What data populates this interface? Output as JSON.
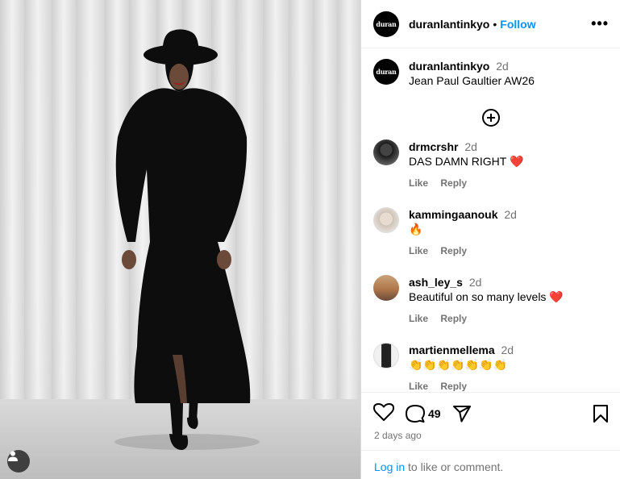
{
  "post": {
    "account": "duranlantinkyo",
    "logo_text": "duran",
    "follow_label": "Follow",
    "separator": "•",
    "more_label": "•••",
    "caption_time": "2d",
    "caption_text": "Jean Paul Gaultier AW26"
  },
  "comments": [
    {
      "user": "drmcrshr",
      "time": "2d",
      "text": "DAS DAMN RIGHT",
      "emoji": "❤️",
      "like": "Like",
      "reply": "Reply"
    },
    {
      "user": "kammingaanouk",
      "time": "2d",
      "text": "",
      "emoji": "🔥",
      "like": "Like",
      "reply": "Reply"
    },
    {
      "user": "ash_ley_s",
      "time": "2d",
      "text": "Beautiful on so many levels",
      "emoji": "❤️",
      "like": "Like",
      "reply": "Reply"
    },
    {
      "user": "martienmellema",
      "time": "2d",
      "text": "",
      "emoji": "👏👏👏👏👏👏👏",
      "like": "Like",
      "reply": "Reply"
    }
  ],
  "stats": {
    "comment_count": "49",
    "posted": "2 days ago"
  },
  "login": {
    "link": "Log in",
    "rest": " to like or comment."
  },
  "colors": {
    "accent": "#0095f6",
    "muted": "#737373",
    "heart": "#ed4956"
  },
  "icons": [
    "tag-user-icon",
    "more-icon",
    "load-more-comments-icon",
    "heart-icon",
    "comment-icon",
    "share-icon",
    "bookmark-icon"
  ]
}
